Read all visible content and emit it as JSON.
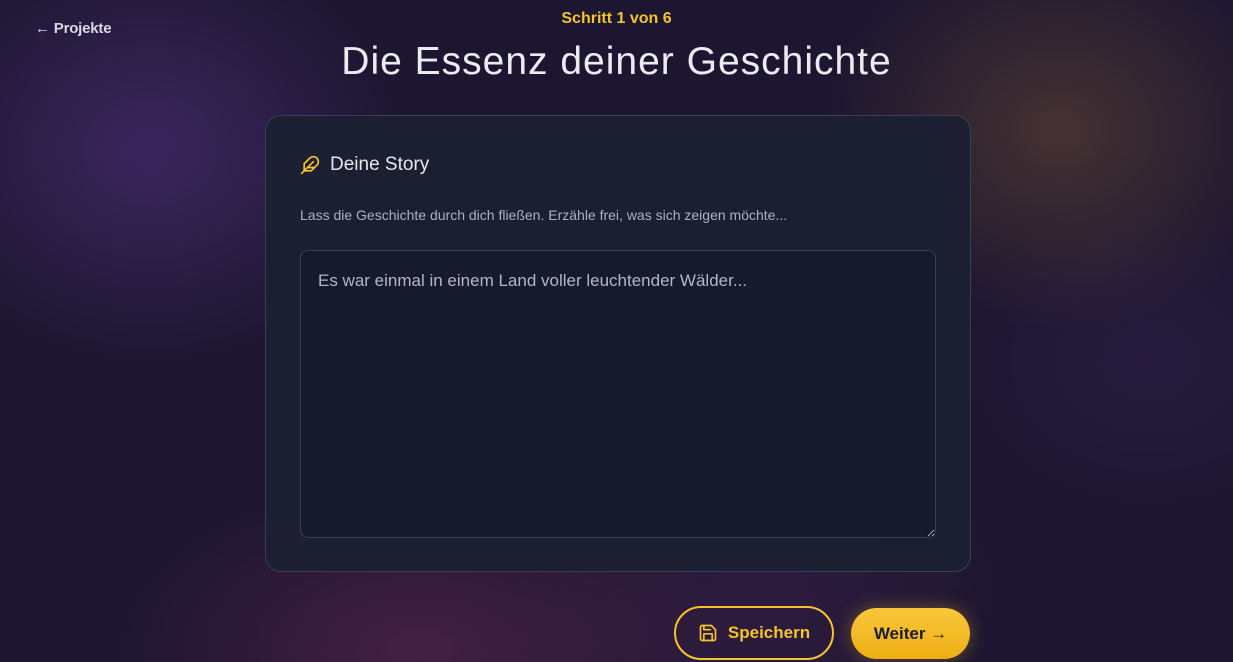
{
  "nav": {
    "back_label": "← Projekte"
  },
  "header": {
    "step_label": "Schritt 1 von 6",
    "title": "Die Essenz deiner Geschichte"
  },
  "card": {
    "icon": "feather-icon",
    "title": "Deine Story",
    "description": "Lass die Geschichte durch dich fließen. Erzähle frei, was sich zeigen möchte...",
    "input": {
      "value": "",
      "placeholder": "Es war einmal in einem Land voller leuchtender Wälder..."
    }
  },
  "actions": {
    "save_icon": "save-icon",
    "save_label": "Speichern",
    "next_label": "Weiter →"
  },
  "colors": {
    "accent": "#f5c32c",
    "background": "#1c1630",
    "card": "#1c2032"
  }
}
